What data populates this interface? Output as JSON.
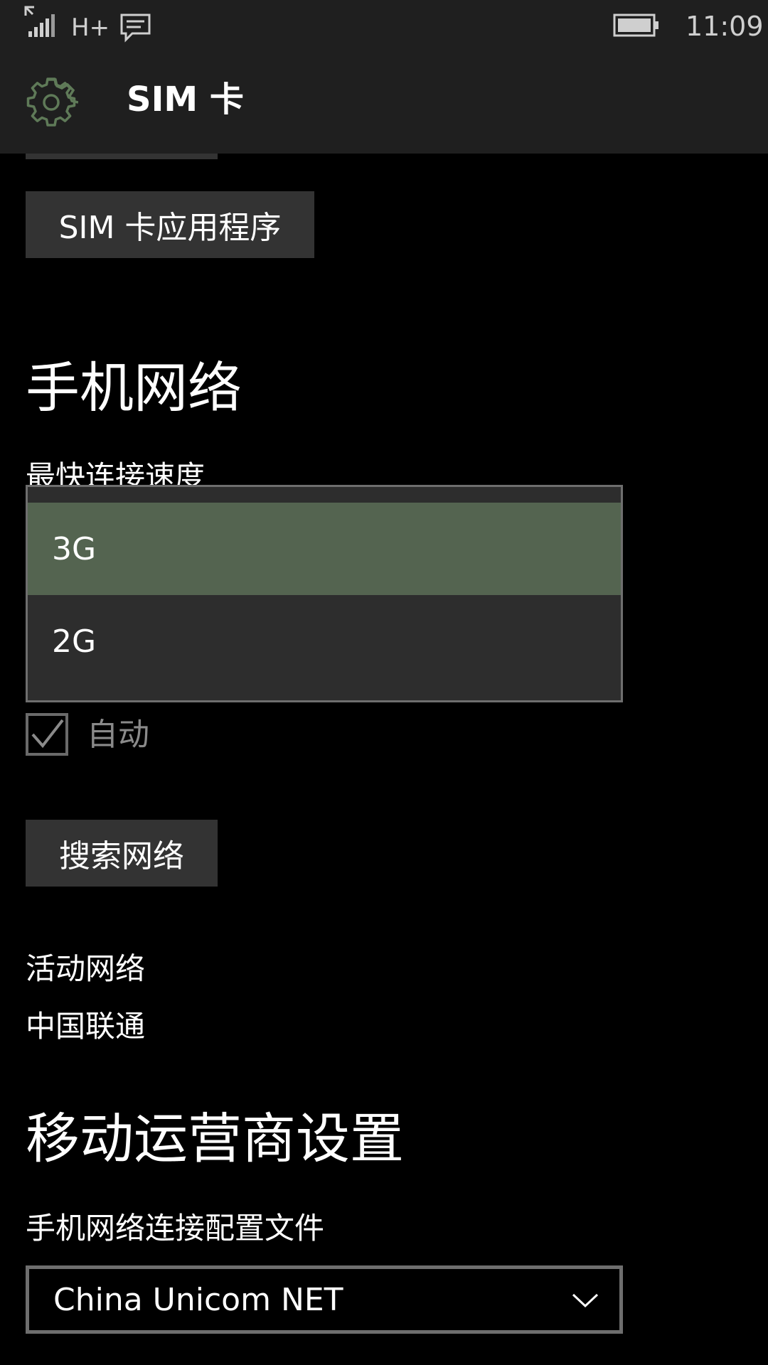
{
  "status_bar": {
    "network_type": "H+",
    "time": "11:09",
    "icons": [
      "signal-icon",
      "message-icon",
      "battery-icon"
    ]
  },
  "header": {
    "title": "SIM 卡",
    "icon": "gear-icon"
  },
  "sim_apps_button": "SIM 卡应用程序",
  "mobile_network": {
    "heading": "手机网络",
    "speed_label": "最快连接速度",
    "speed_options": [
      "3G",
      "2G"
    ],
    "selected_option": "3G",
    "auto_checkbox_label": "自动",
    "auto_checked": true,
    "search_button": "搜索网络",
    "active_network_label": "活动网络",
    "active_network_value": "中国联通"
  },
  "carrier_settings": {
    "heading": "移动运营商设置",
    "profile_label": "手机网络连接配置文件",
    "profile_value": "China Unicom NET"
  },
  "colors": {
    "accent": "#546450",
    "dropdown_bg": "#2d2d2d",
    "header_bg": "#1f1f1f"
  }
}
